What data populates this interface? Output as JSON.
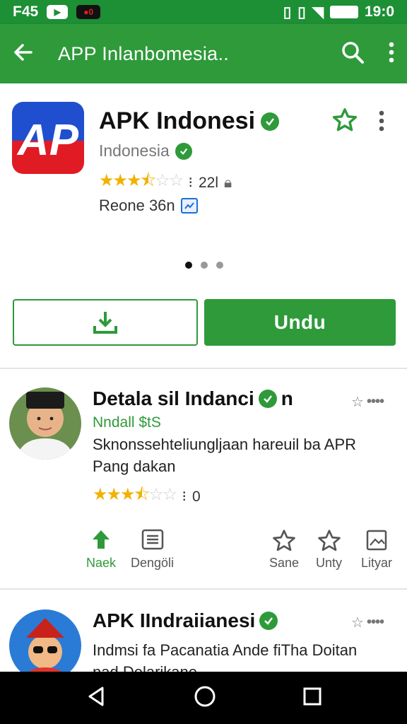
{
  "status": {
    "carrier": "F45",
    "time": "19:0"
  },
  "appbar": {
    "title": "APP Inlanbomesia.."
  },
  "app": {
    "name": "APK Indonesi",
    "developer": "Indonesia",
    "icon_text": "AP",
    "rating_stars": 3.5,
    "rating_count": "22l",
    "recent": "Reone 36n",
    "download_label": "Undu"
  },
  "review1": {
    "title": "Detala sil Indanci",
    "title_suffix": "n",
    "subtitle": "Nndall $tS",
    "text": "Sknonssehteliunglјaan hareuil ba APR Pang dakan",
    "rating_stars": 3.5,
    "rating_count": "0",
    "actions": [
      {
        "icon": "up-arrow-icon",
        "label": "Naek",
        "active": true
      },
      {
        "icon": "list-icon",
        "label": "Dengöli",
        "active": false
      },
      {
        "icon": "star-outline-icon",
        "label": "Sane",
        "active": false
      },
      {
        "icon": "star-outline-icon",
        "label": "Unty",
        "active": false
      },
      {
        "icon": "image-icon",
        "label": "Lityar",
        "active": false
      }
    ]
  },
  "review2": {
    "title": "APK IIndraiianesi",
    "text": "Indmsi fa Pacanatia Ande fiTha Doitan nad Delarikane"
  },
  "colors": {
    "accent": "#2e9a3a",
    "star": "#f2b100"
  }
}
